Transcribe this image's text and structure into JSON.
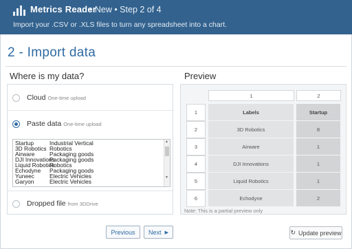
{
  "header": {
    "app_title": "Metrics Reader",
    "step": "• New • Step 2 of 4",
    "subtitle": "Import your .CSV or .XLS files to turn any spreadsheet into a chart."
  },
  "page_title": "2 - Import data",
  "left": {
    "title": "Where is my data?",
    "options": [
      {
        "label": "Cloud",
        "sublabel": "One-time upload",
        "selected": false
      },
      {
        "label": "Paste data",
        "sublabel": "One-time upload",
        "selected": true
      },
      {
        "label": "Dropped file",
        "sublabel": "from 3DDrive",
        "selected": false
      }
    ],
    "pasted_lines": [
      [
        "Startup",
        "Industrial Vertical"
      ],
      [
        "3D Robotics",
        "Robotics"
      ],
      [
        "Airware",
        "Packaging goods"
      ],
      [
        "DJI Innovations",
        "Packaging goods"
      ],
      [
        "Liquid Robotics",
        "Robotics"
      ],
      [
        "Echodyne",
        "Packaging goods"
      ],
      [
        "Yuneec",
        "Electric Vehicles"
      ],
      [
        "Garyon",
        "Electric Vehicles"
      ]
    ]
  },
  "preview": {
    "title": "Preview",
    "col_numbers": [
      "1",
      "2"
    ],
    "headers": [
      "Labels",
      "Startup"
    ],
    "rows": [
      {
        "num": "1",
        "label": "Labels",
        "value": "Startup"
      },
      {
        "num": "2",
        "label": "3D Robotics",
        "value": "8"
      },
      {
        "num": "3",
        "label": "Airware",
        "value": "1"
      },
      {
        "num": "4",
        "label": "DJI Innovations",
        "value": "1"
      },
      {
        "num": "5",
        "label": "Liquid Robotics",
        "value": "1"
      },
      {
        "num": "6",
        "label": "Echodyne",
        "value": "2"
      }
    ],
    "note": "Note: This is a partial preview only",
    "update_label": "Update preview"
  },
  "nav": {
    "previous_label": "Previous",
    "next_label": "Next"
  },
  "colors": {
    "header_bg": "#33628e",
    "accent": "#2f6aa3"
  }
}
